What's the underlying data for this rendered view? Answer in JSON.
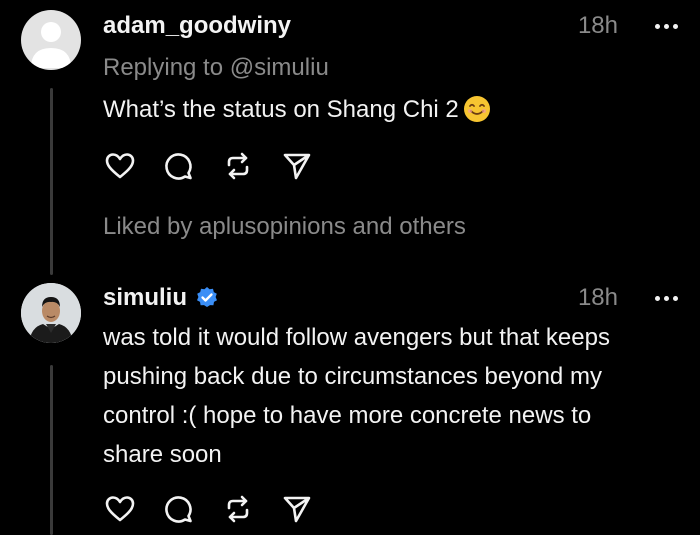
{
  "posts": [
    {
      "username": "adam_goodwiny",
      "time": "18h",
      "replying": "Replying to @simuliu",
      "text": "What’s the status on Shang Chi 2",
      "emoji_name": "smiling-face-icon",
      "liked_by": "Liked by aplusopinions and others"
    },
    {
      "username": "simuliu",
      "verified": true,
      "time": "18h",
      "lines": [
        "was told it would follow avengers but that keeps",
        "pushing back due to circumstances beyond my",
        "control :( hope to have more concrete news to",
        "share soon"
      ]
    }
  ],
  "icons": {
    "like": "heart-icon",
    "reply": "comment-icon",
    "repost": "repost-icon",
    "share": "send-icon",
    "more": "more-icon"
  },
  "colors": {
    "background": "#000000",
    "text": "#f3f3f3",
    "muted": "#8a8a8a",
    "verified": "#3a8ef6"
  }
}
